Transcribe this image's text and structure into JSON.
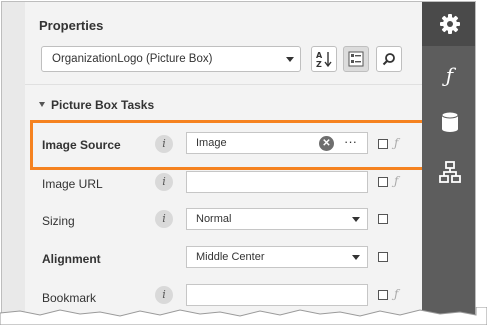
{
  "panel": {
    "title": "Properties",
    "selector": {
      "value": "OrganizationLogo (Picture Box)"
    },
    "toolbar": [
      "sort-alphabetical",
      "categorized-view",
      "search"
    ],
    "section": "Picture Box Tasks",
    "rows": [
      {
        "label": "Image Source",
        "bold": true,
        "value": "Image",
        "control": "text-clear-ellipsis",
        "highlighted": true
      },
      {
        "label": "Image URL",
        "bold": false,
        "value": "",
        "control": "text"
      },
      {
        "label": "Sizing",
        "bold": false,
        "value": "Normal",
        "control": "dropdown"
      },
      {
        "label": "Alignment",
        "bold": true,
        "value": "Middle Center",
        "control": "dropdown"
      },
      {
        "label": "Bookmark",
        "bold": false,
        "value": "",
        "control": "text"
      }
    ]
  },
  "sidebar": [
    "gear-icon",
    "function-icon",
    "database-icon",
    "hierarchy-icon"
  ],
  "colors": {
    "highlight": "#f58220",
    "sidebar": "#5d5d5d"
  }
}
